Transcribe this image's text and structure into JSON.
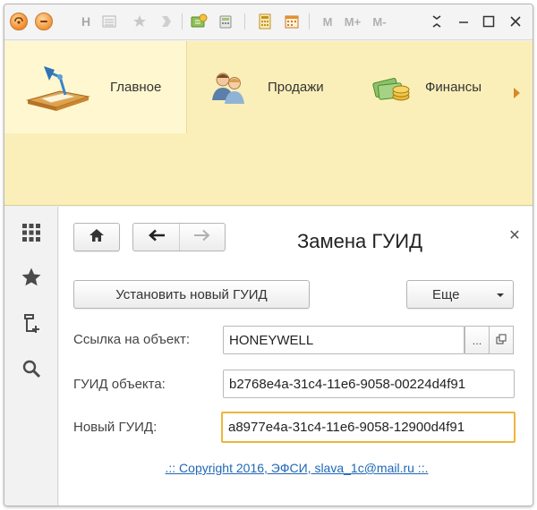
{
  "titlebar": {
    "icons": [
      "1c-logo-icon",
      "minimize-menu-icon",
      "h-icon",
      "list-icon",
      "star-faded-icon",
      "history-icon",
      "forward-faded-icon",
      "refresh-icon",
      "calculator-icon",
      "calendar-icon",
      "m-icon",
      "m-plus-icon",
      "m-minus-icon",
      "expand-icon"
    ],
    "h_label": "H",
    "m_label": "M",
    "m_plus_label": "M+",
    "m_minus_label": "M-"
  },
  "sections": [
    {
      "label": "Главное",
      "icon": "desk-lamp-icon",
      "active": true
    },
    {
      "label": "Продажи",
      "icon": "people-icon",
      "active": false
    },
    {
      "label": "Финансы",
      "icon": "money-icon",
      "active": false
    }
  ],
  "left_tools": [
    "grid-menu-icon",
    "favorites-star-icon",
    "history-icon",
    "search-icon"
  ],
  "form": {
    "title": "Замена ГУИД",
    "set_new_guid_label": "Установить новый ГУИД",
    "more_label": "Еще",
    "ref_label": "Ссылка на объект:",
    "ref_value": "HONEYWELL",
    "ref_choose": "...",
    "object_guid_label": "ГУИД объекта:",
    "object_guid_value": "b2768e4a-31c4-11e6-9058-00224d4f91",
    "new_guid_label": "Новый ГУИД:",
    "new_guid_value": "a8977e4a-31c4-11e6-9058-12900d4f91",
    "copyright": ".:: Copyright 2016, ЭФСИ, slava_1c@mail.ru ::."
  }
}
